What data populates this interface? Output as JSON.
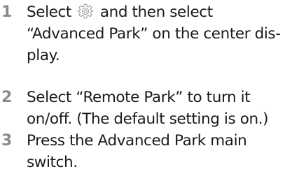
{
  "steps": [
    {
      "number": "1",
      "before_icon": "Select",
      "icon": "gear-icon",
      "line1_after_icon": "and then select",
      "line2": "“Advanced Park” on the center dis-",
      "line3": "play."
    },
    {
      "number": "2",
      "line1": "Select “Remote Park” to turn it",
      "line2": "on/off. (The default setting is on.)"
    },
    {
      "number": "3",
      "line1": "Press the Advanced Park main",
      "line2": "switch."
    }
  ],
  "colors": {
    "step_number": "#8a8a8a",
    "text": "#1a1a1a",
    "icon_stroke": "#a0a0a0"
  }
}
